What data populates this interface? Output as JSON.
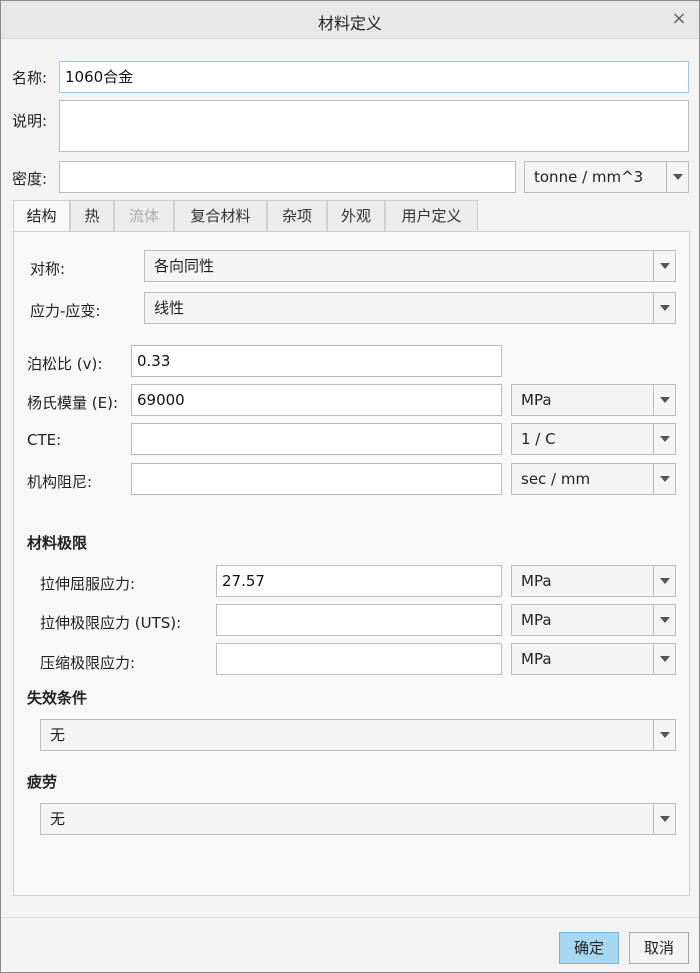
{
  "window": {
    "title": "材料定义",
    "close_icon": "×"
  },
  "fields": {
    "name_label": "名称:",
    "name_value": "1060合金",
    "description_label": "说明:",
    "description_value": "",
    "density_label": "密度:",
    "density_value": "",
    "density_unit": "tonne / mm^3"
  },
  "tabs": [
    {
      "label": "结构",
      "active": true
    },
    {
      "label": "热"
    },
    {
      "label": "流体",
      "disabled": true
    },
    {
      "label": "复合材料"
    },
    {
      "label": "杂项"
    },
    {
      "label": "外观"
    },
    {
      "label": "用户定义"
    }
  ],
  "structural": {
    "symmetry_label": "对称:",
    "symmetry_value": "各向同性",
    "stress_strain_label": "应力-应变:",
    "stress_strain_value": "线性",
    "poisson_label": "泊松比 (v):",
    "poisson_value": "0.33",
    "youngs_label": "杨氏模量 (E):",
    "youngs_value": "69000",
    "youngs_unit": "MPa",
    "cte_label": "CTE:",
    "cte_value": "",
    "cte_unit": "1 / C",
    "damping_label": "机构阻尼:",
    "damping_value": "",
    "damping_unit": "sec / mm"
  },
  "limits": {
    "title": "材料极限",
    "tensile_yield_label": "拉伸屈服应力:",
    "tensile_yield_value": "27.57",
    "tensile_yield_unit": "MPa",
    "uts_label": "拉伸极限应力 (UTS):",
    "uts_value": "",
    "uts_unit": "MPa",
    "compressive_label": "压缩极限应力:",
    "compressive_value": "",
    "compressive_unit": "MPa"
  },
  "failure": {
    "title": "失效条件",
    "value": "无"
  },
  "fatigue": {
    "title": "疲劳",
    "value": "无"
  },
  "buttons": {
    "ok": "确定",
    "cancel": "取消"
  }
}
